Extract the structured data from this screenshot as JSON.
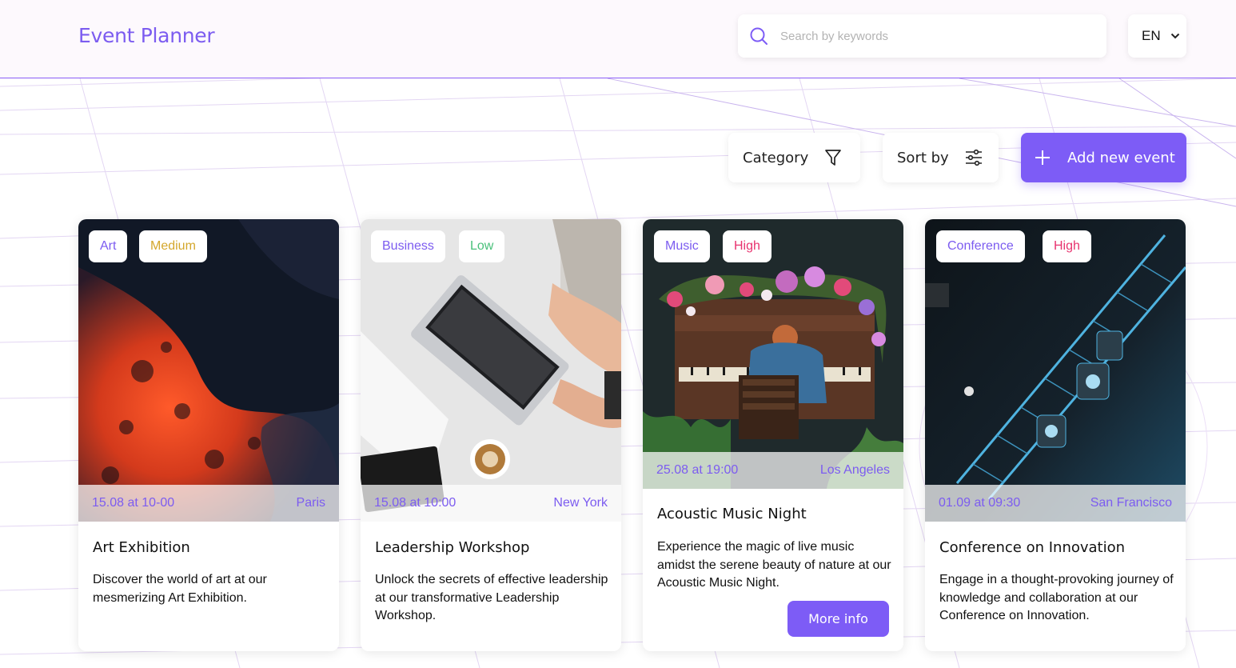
{
  "app": {
    "title": "Event Planner"
  },
  "search": {
    "placeholder": "Search by keywords",
    "value": ""
  },
  "language": {
    "selected": "EN"
  },
  "toolbar": {
    "category_label": "Category",
    "sort_label": "Sort by",
    "add_label": "Add new event"
  },
  "colors": {
    "accent": "#7d5cf6",
    "medium": "#d4a72c",
    "low": "#49c07a",
    "high": "#e8336f"
  },
  "events": [
    {
      "category": "Art",
      "priority": "Medium",
      "datetime": "15.08 at 10-00",
      "location": "Paris",
      "title": "Art Exhibition",
      "description": "Discover the world of art at our mesmerizing Art Exhibition."
    },
    {
      "category": "Business",
      "priority": "Low",
      "datetime": "15.08 at 10:00",
      "location": "New York",
      "title": "Leadership Workshop",
      "description": "Unlock the secrets of effective leadership at our transformative Leadership Workshop."
    },
    {
      "category": "Music",
      "priority": "High",
      "datetime": "25.08 at 19:00",
      "location": "Los Angeles",
      "title": "Acoustic Music Night",
      "description": "Experience the magic of live music amidst the serene beauty of nature at our Acoustic Music Night.",
      "action": "More info"
    },
    {
      "category": "Conference",
      "priority": "High",
      "datetime": "01.09 at 09:30",
      "location": "San Francisco",
      "title": "Conference on Innovation",
      "description": "Engage in a thought-provoking journey of knowledge and collaboration at our Conference on Innovation."
    }
  ]
}
